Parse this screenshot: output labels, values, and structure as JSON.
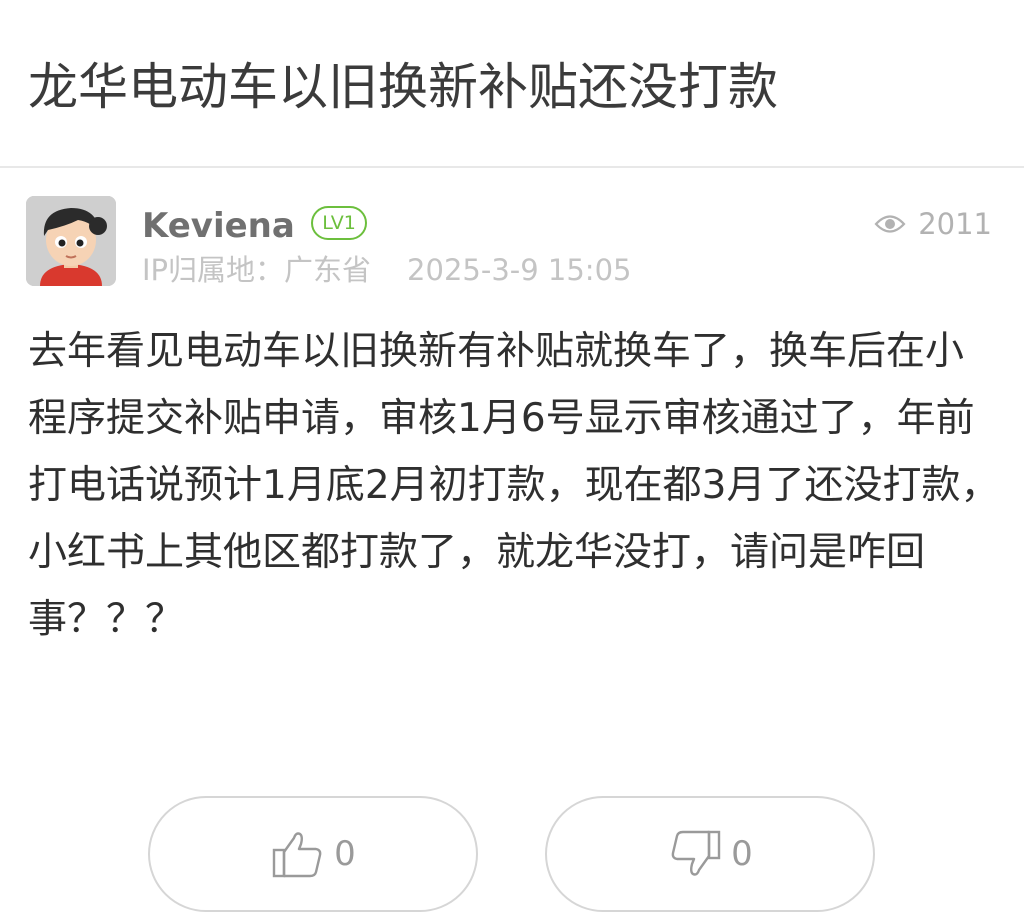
{
  "post": {
    "title": "龙华电动车以旧换新补贴还没打款",
    "author": {
      "name": "Keviena",
      "level": "LV1",
      "ip_location": "IP归属地：广东省",
      "datetime": "2025-3-9 15:05"
    },
    "views": "2011",
    "body": "去年看见电动车以旧换新有补贴就换车了，换车后在小程序提交补贴申请，审核1月6号显示审核通过了，年前打电话说预计1月底2月初打款，现在都3月了还没打款，小红书上其他区都打款了，就龙华没打，请问是咋回事？？？"
  },
  "actions": {
    "like_count": "0",
    "dislike_count": "0"
  },
  "icons": {
    "views": "eye-icon",
    "like": "thumbs-up-icon",
    "dislike": "thumbs-down-icon"
  },
  "colors": {
    "level_badge": "#6cbf3d",
    "muted_text": "#c4c4c4"
  }
}
